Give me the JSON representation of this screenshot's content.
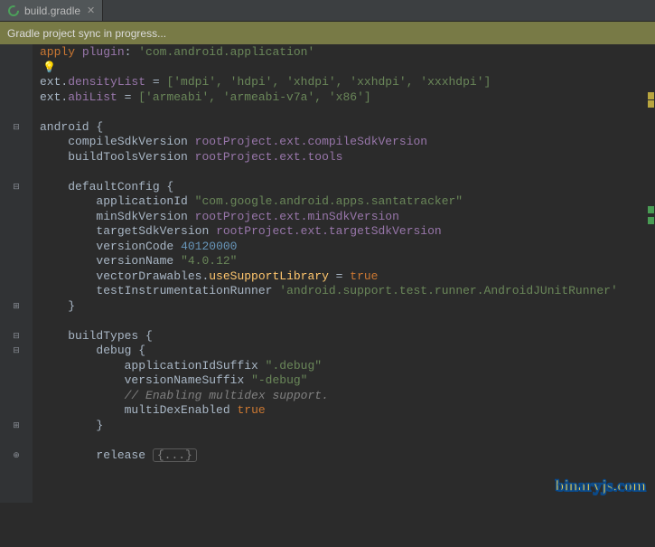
{
  "tab": {
    "label": "build.gradle",
    "iconColor": "#4ca05a"
  },
  "syncMessage": "Gradle project sync in progress...",
  "watermark": "binaryjs.com",
  "code": {
    "applyPlugin": {
      "kw": "apply",
      "id": "plugin",
      "val": "'com.android.application'"
    },
    "densityList": {
      "prefix": "ext.",
      "id": "densityList",
      "vals": "['mdpi', 'hdpi', 'xhdpi', 'xxhdpi', 'xxxhdpi']"
    },
    "abiList": {
      "prefix": "ext.",
      "id": "abiList",
      "vals": "['armeabi', 'armeabi-v7a', 'x86']"
    },
    "android": "android {",
    "compileSdk": {
      "lhs": "compileSdkVersion",
      "rhs": "rootProject.ext.compileSdkVersion"
    },
    "buildTools": {
      "lhs": "buildToolsVersion",
      "rhs": "rootProject.ext.tools"
    },
    "defaultConfig": "defaultConfig {",
    "appId": {
      "lhs": "applicationId",
      "val": "\"com.google.android.apps.santatracker\""
    },
    "minSdk": {
      "lhs": "minSdkVersion",
      "rhs": "rootProject.ext.minSdkVersion"
    },
    "targetSdk": {
      "lhs": "targetSdkVersion",
      "rhs": "rootProject.ext.targetSdkVersion"
    },
    "versionCode": {
      "lhs": "versionCode",
      "val": "40120000"
    },
    "versionName": {
      "lhs": "versionName",
      "val": "\"4.0.12\""
    },
    "vectorDraw": {
      "lhs": "vectorDrawables.",
      "fn": "useSupportLibrary",
      "eq": " = ",
      "val": "true"
    },
    "testRunner": {
      "lhs": "testInstrumentationRunner",
      "val": "'android.support.test.runner.AndroidJUnitRunner'"
    },
    "closeBrace": "}",
    "buildTypes": "buildTypes {",
    "debug": "debug {",
    "appIdSuffix": {
      "lhs": "applicationIdSuffix",
      "val": "\".debug\""
    },
    "versionNameSuffix": {
      "lhs": "versionNameSuffix",
      "val": "\"-debug\""
    },
    "multidexComment": "// Enabling multidex support.",
    "multiDex": {
      "lhs": "multiDexEnabled",
      "val": "true"
    },
    "release": "release",
    "folded": "{...}"
  }
}
